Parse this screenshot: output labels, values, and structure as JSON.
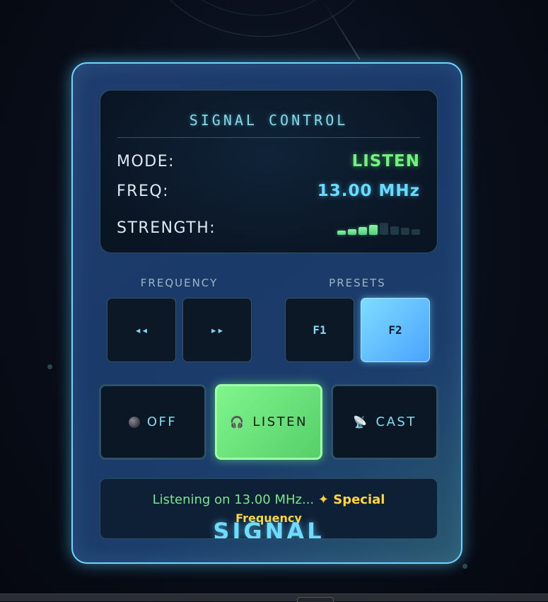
{
  "panel": {
    "title": "SIGNAL CONTROL",
    "mode_label": "MODE:",
    "mode_value": "LISTEN",
    "freq_label": "FREQ:",
    "freq_value": "13.00 MHz",
    "strength_label": "STRENGTH:",
    "strength_level": 4,
    "strength_max": 8
  },
  "frequency": {
    "label": "FREQUENCY",
    "down_label": "◂◂",
    "up_label": "▸▸"
  },
  "presets": {
    "label": "PRESETS",
    "f1_label": "F1",
    "f2_label": "F2",
    "active": "F2"
  },
  "modes": {
    "off_label": "OFF",
    "listen_label": "LISTEN",
    "cast_label": "CAST",
    "active": "LISTEN",
    "off_icon": "power-off-icon",
    "listen_icon": "headphones-icon",
    "cast_icon": "satellite-dish-icon"
  },
  "status": {
    "text": "Listening on 13.00 MHz...",
    "special_prefix": "✦ Special",
    "special_suffix": "Frequency"
  },
  "brand": "SIGNAL",
  "colors": {
    "accent": "#6fd6ff",
    "listen_green": "#72f27e",
    "special_yellow": "#ffd640",
    "preset_active": "#4aa3ff"
  }
}
